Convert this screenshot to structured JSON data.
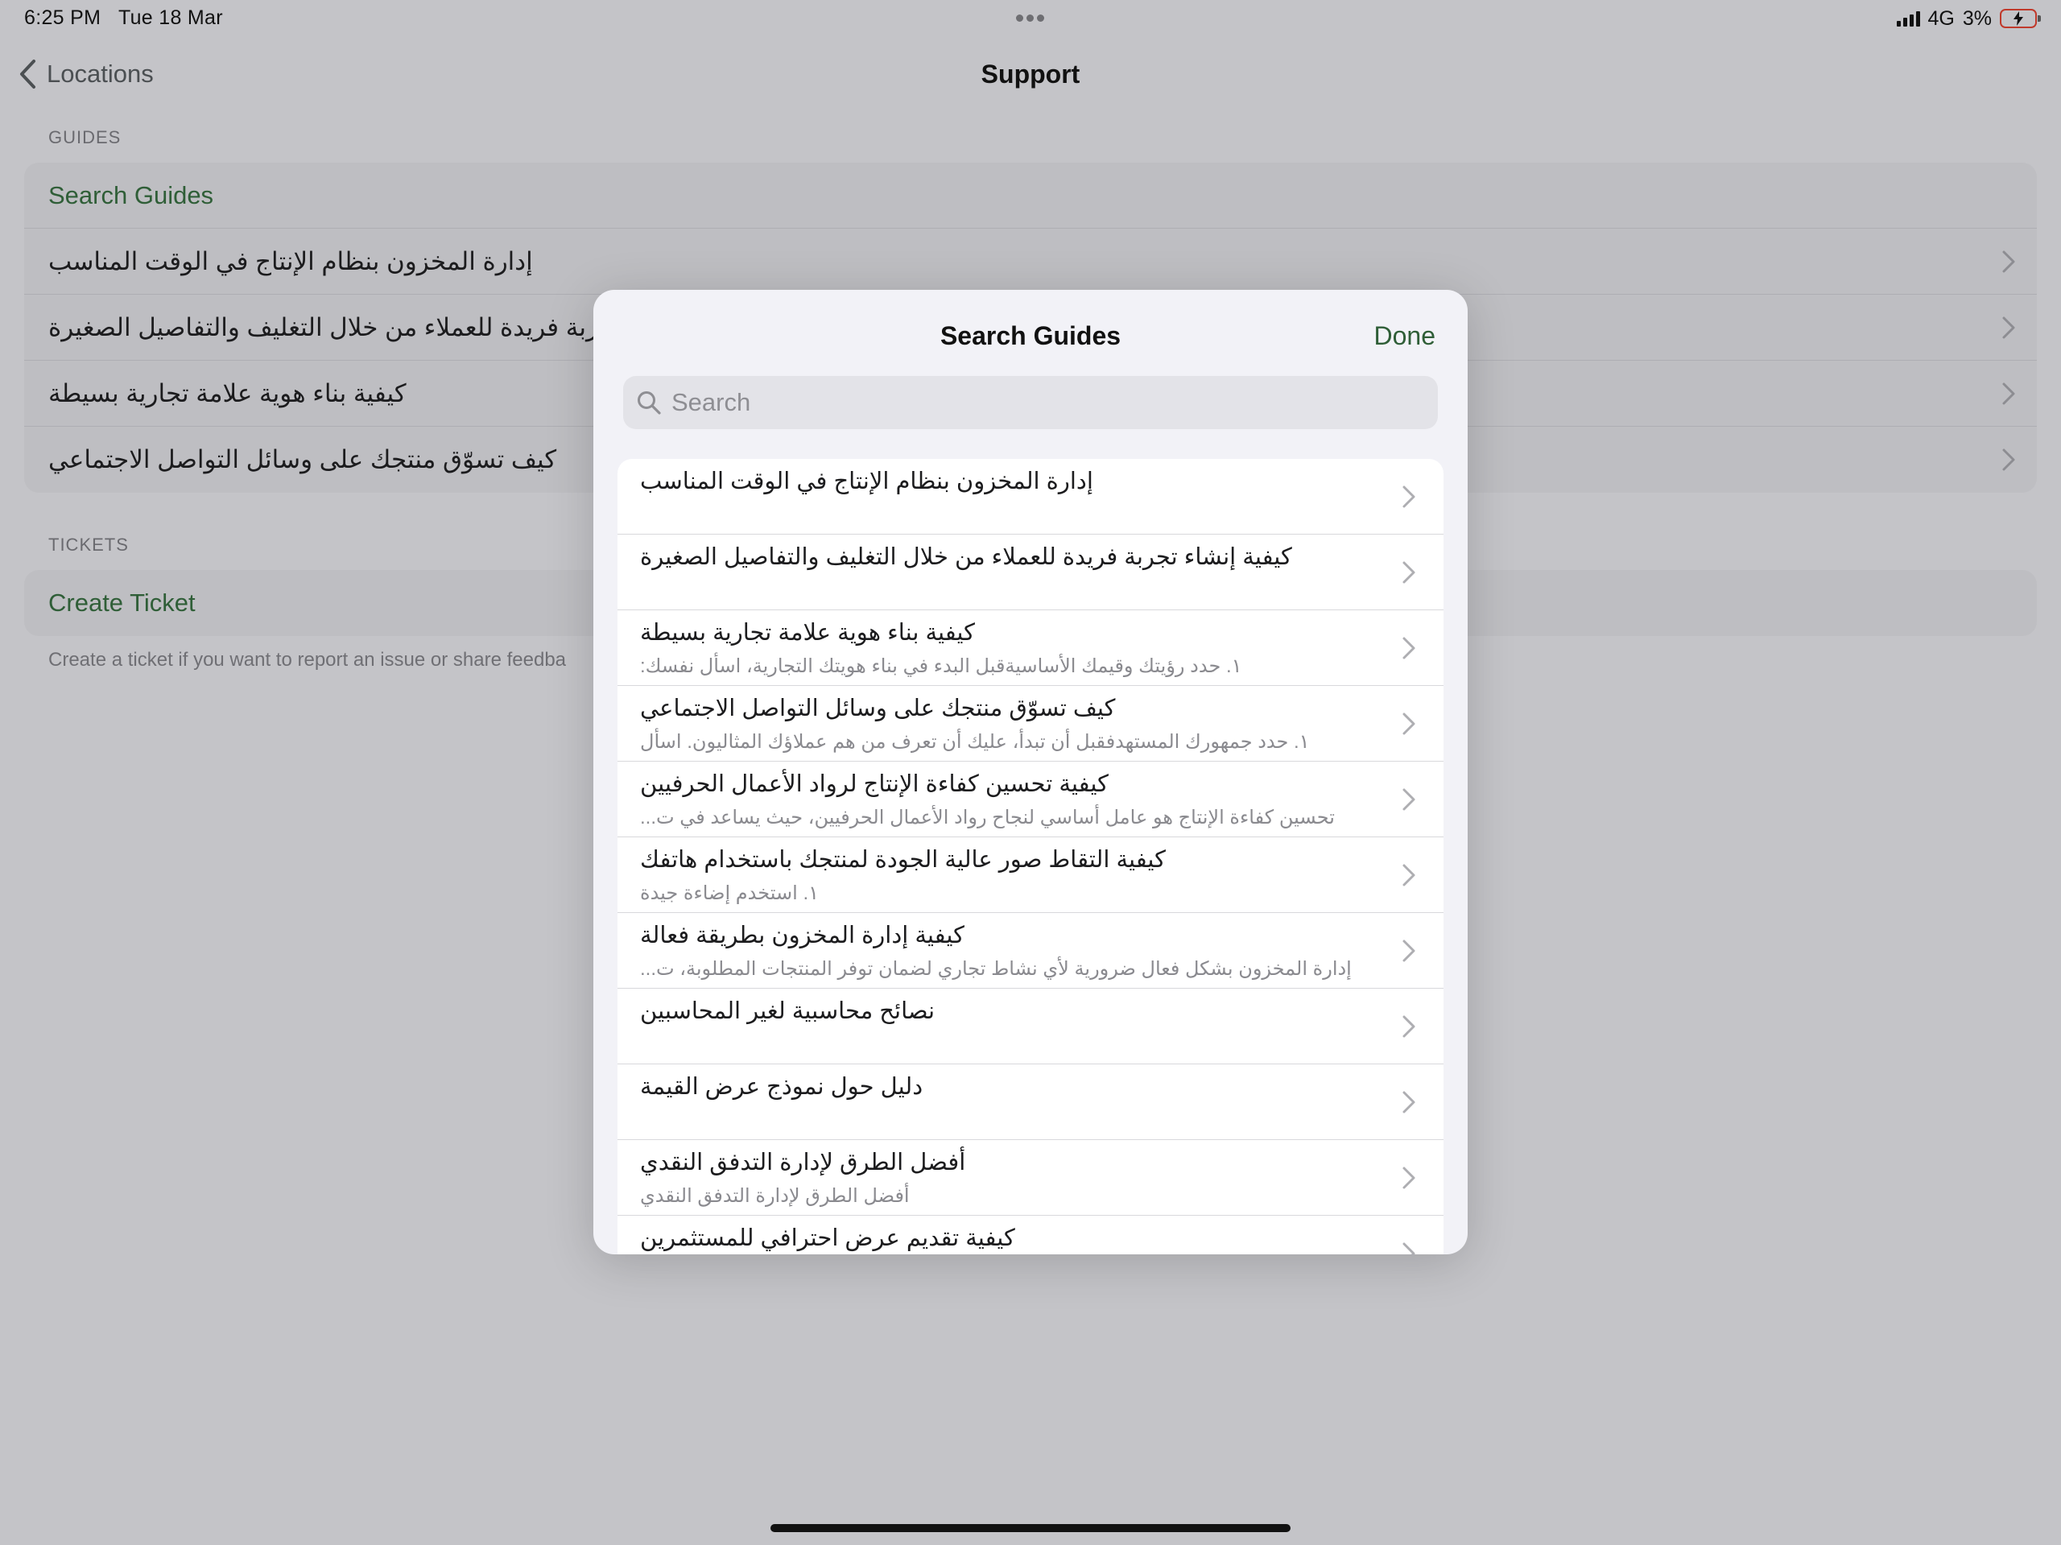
{
  "status_bar": {
    "time": "6:25 PM",
    "date": "Tue 18 Mar",
    "network": "4G",
    "battery": "3%"
  },
  "nav": {
    "back_label": "Locations",
    "title": "Support"
  },
  "guides": {
    "header": "GUIDES",
    "search_label": "Search Guides",
    "items": [
      "إدارة المخزون بنظام الإنتاج في الوقت المناسب",
      "كيفية إنشاء تجربة فريدة للعملاء من خلال التغليف والتفاصيل الصغيرة",
      "كيفية بناء هوية علامة تجارية بسيطة",
      "كيف تسوّق منتجك على وسائل التواصل الاجتماعي"
    ]
  },
  "tickets": {
    "header": "TICKETS",
    "create_label": "Create Ticket",
    "footer": "Create a ticket if you want to report an issue or share feedba"
  },
  "modal": {
    "title": "Search Guides",
    "done_label": "Done",
    "search_placeholder": "Search",
    "results": [
      {
        "title": "إدارة المخزون بنظام الإنتاج في الوقت المناسب",
        "subtitle": ""
      },
      {
        "title": "كيفية إنشاء تجربة فريدة للعملاء من خلال التغليف والتفاصيل الصغيرة",
        "subtitle": ""
      },
      {
        "title": "كيفية بناء هوية علامة تجارية بسيطة",
        "subtitle": "١. حدد رؤيتك وقيمك الأساسيةقبل البدء في بناء هويتك التجارية، اسأل نفسك:"
      },
      {
        "title": "كيف تسوّق منتجك على وسائل التواصل الاجتماعي",
        "subtitle": "١. حدد جمهورك المستهدفقبل أن تبدأ، عليك أن تعرف من هم عملاؤك المثاليون. اسأل"
      },
      {
        "title": "كيفية تحسين كفاءة الإنتاج لرواد الأعمال الحرفيين",
        "subtitle": "تحسين كفاءة الإنتاج هو عامل أساسي لنجاح رواد الأعمال الحرفيين، حيث يساعد في ت..."
      },
      {
        "title": "كيفية التقاط صور عالية الجودة لمنتجك باستخدام هاتفك",
        "subtitle": "١. استخدم إضاءة جيدة"
      },
      {
        "title": "كيفية إدارة المخزون بطريقة فعالة",
        "subtitle": "إدارة المخزون بشكل فعال ضرورية لأي نشاط تجاري لضمان توفر المنتجات المطلوبة، ت..."
      },
      {
        "title": "نصائح محاسبية لغير المحاسبين",
        "subtitle": ""
      },
      {
        "title": "دليل حول نموذج عرض القيمة",
        "subtitle": ""
      },
      {
        "title": "أفضل الطرق لإدارة التدفق النقدي",
        "subtitle": "أفضل الطرق لإدارة التدفق النقدي"
      },
      {
        "title": "كيفية تقديم عرض احترافي للمستثمرين",
        "subtitle": ""
      }
    ]
  },
  "colors": {
    "accent": "#2f5e37",
    "backdrop": "#c4c4c8"
  },
  "icons": {
    "back": "chevron-left-icon",
    "row": "chevron-right-icon",
    "search": "magnifier-icon",
    "battery": "battery-charging-icon",
    "signal": "cellular-signal-icon"
  }
}
